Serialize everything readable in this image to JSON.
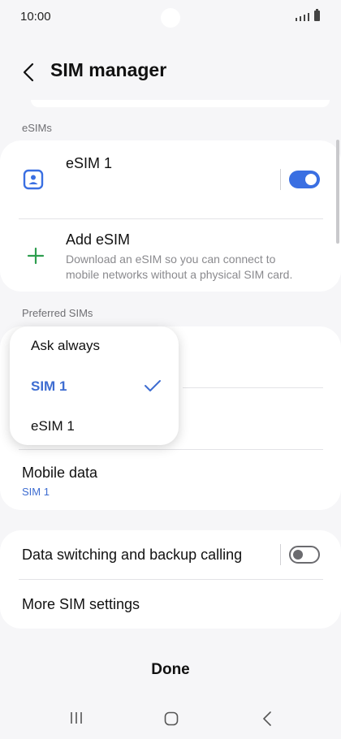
{
  "status_bar": {
    "time": "10:00"
  },
  "header": {
    "title": "SIM manager"
  },
  "esims_section": {
    "label": "eSIMs",
    "esim1": {
      "name": "eSIM 1",
      "enabled": true
    },
    "add": {
      "title": "Add eSIM",
      "description_line1": "Download an eSIM so you can connect to",
      "description_line2": "mobile networks without a physical SIM card."
    }
  },
  "preferred_section": {
    "label": "Preferred SIMs",
    "mobile_data": {
      "title": "Mobile data",
      "value": "SIM 1"
    }
  },
  "dropdown": {
    "options": [
      "Ask always",
      "SIM 1",
      "eSIM 1"
    ],
    "selected": "SIM 1"
  },
  "more": {
    "data_switching": {
      "label": "Data switching and backup calling",
      "enabled": false
    },
    "more_settings": {
      "label": "More SIM settings"
    }
  },
  "footer": {
    "done_label": "Done"
  },
  "colors": {
    "accent": "#3a6fe2",
    "add_icon": "#2e9e4f",
    "background": "#f6f6f8"
  }
}
